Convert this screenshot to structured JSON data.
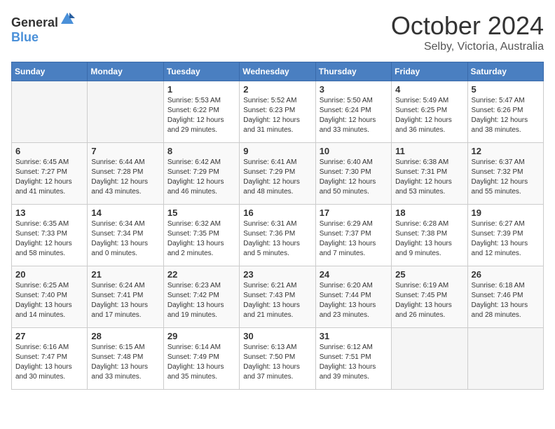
{
  "header": {
    "logo_general": "General",
    "logo_blue": "Blue",
    "month": "October 2024",
    "location": "Selby, Victoria, Australia"
  },
  "days_of_week": [
    "Sunday",
    "Monday",
    "Tuesday",
    "Wednesday",
    "Thursday",
    "Friday",
    "Saturday"
  ],
  "weeks": [
    [
      {
        "day": "",
        "sunrise": "",
        "sunset": "",
        "daylight": ""
      },
      {
        "day": "",
        "sunrise": "",
        "sunset": "",
        "daylight": ""
      },
      {
        "day": "1",
        "sunrise": "Sunrise: 5:53 AM",
        "sunset": "Sunset: 6:22 PM",
        "daylight": "Daylight: 12 hours and 29 minutes."
      },
      {
        "day": "2",
        "sunrise": "Sunrise: 5:52 AM",
        "sunset": "Sunset: 6:23 PM",
        "daylight": "Daylight: 12 hours and 31 minutes."
      },
      {
        "day": "3",
        "sunrise": "Sunrise: 5:50 AM",
        "sunset": "Sunset: 6:24 PM",
        "daylight": "Daylight: 12 hours and 33 minutes."
      },
      {
        "day": "4",
        "sunrise": "Sunrise: 5:49 AM",
        "sunset": "Sunset: 6:25 PM",
        "daylight": "Daylight: 12 hours and 36 minutes."
      },
      {
        "day": "5",
        "sunrise": "Sunrise: 5:47 AM",
        "sunset": "Sunset: 6:26 PM",
        "daylight": "Daylight: 12 hours and 38 minutes."
      }
    ],
    [
      {
        "day": "6",
        "sunrise": "Sunrise: 6:45 AM",
        "sunset": "Sunset: 7:27 PM",
        "daylight": "Daylight: 12 hours and 41 minutes."
      },
      {
        "day": "7",
        "sunrise": "Sunrise: 6:44 AM",
        "sunset": "Sunset: 7:28 PM",
        "daylight": "Daylight: 12 hours and 43 minutes."
      },
      {
        "day": "8",
        "sunrise": "Sunrise: 6:42 AM",
        "sunset": "Sunset: 7:29 PM",
        "daylight": "Daylight: 12 hours and 46 minutes."
      },
      {
        "day": "9",
        "sunrise": "Sunrise: 6:41 AM",
        "sunset": "Sunset: 7:29 PM",
        "daylight": "Daylight: 12 hours and 48 minutes."
      },
      {
        "day": "10",
        "sunrise": "Sunrise: 6:40 AM",
        "sunset": "Sunset: 7:30 PM",
        "daylight": "Daylight: 12 hours and 50 minutes."
      },
      {
        "day": "11",
        "sunrise": "Sunrise: 6:38 AM",
        "sunset": "Sunset: 7:31 PM",
        "daylight": "Daylight: 12 hours and 53 minutes."
      },
      {
        "day": "12",
        "sunrise": "Sunrise: 6:37 AM",
        "sunset": "Sunset: 7:32 PM",
        "daylight": "Daylight: 12 hours and 55 minutes."
      }
    ],
    [
      {
        "day": "13",
        "sunrise": "Sunrise: 6:35 AM",
        "sunset": "Sunset: 7:33 PM",
        "daylight": "Daylight: 12 hours and 58 minutes."
      },
      {
        "day": "14",
        "sunrise": "Sunrise: 6:34 AM",
        "sunset": "Sunset: 7:34 PM",
        "daylight": "Daylight: 13 hours and 0 minutes."
      },
      {
        "day": "15",
        "sunrise": "Sunrise: 6:32 AM",
        "sunset": "Sunset: 7:35 PM",
        "daylight": "Daylight: 13 hours and 2 minutes."
      },
      {
        "day": "16",
        "sunrise": "Sunrise: 6:31 AM",
        "sunset": "Sunset: 7:36 PM",
        "daylight": "Daylight: 13 hours and 5 minutes."
      },
      {
        "day": "17",
        "sunrise": "Sunrise: 6:29 AM",
        "sunset": "Sunset: 7:37 PM",
        "daylight": "Daylight: 13 hours and 7 minutes."
      },
      {
        "day": "18",
        "sunrise": "Sunrise: 6:28 AM",
        "sunset": "Sunset: 7:38 PM",
        "daylight": "Daylight: 13 hours and 9 minutes."
      },
      {
        "day": "19",
        "sunrise": "Sunrise: 6:27 AM",
        "sunset": "Sunset: 7:39 PM",
        "daylight": "Daylight: 13 hours and 12 minutes."
      }
    ],
    [
      {
        "day": "20",
        "sunrise": "Sunrise: 6:25 AM",
        "sunset": "Sunset: 7:40 PM",
        "daylight": "Daylight: 13 hours and 14 minutes."
      },
      {
        "day": "21",
        "sunrise": "Sunrise: 6:24 AM",
        "sunset": "Sunset: 7:41 PM",
        "daylight": "Daylight: 13 hours and 17 minutes."
      },
      {
        "day": "22",
        "sunrise": "Sunrise: 6:23 AM",
        "sunset": "Sunset: 7:42 PM",
        "daylight": "Daylight: 13 hours and 19 minutes."
      },
      {
        "day": "23",
        "sunrise": "Sunrise: 6:21 AM",
        "sunset": "Sunset: 7:43 PM",
        "daylight": "Daylight: 13 hours and 21 minutes."
      },
      {
        "day": "24",
        "sunrise": "Sunrise: 6:20 AM",
        "sunset": "Sunset: 7:44 PM",
        "daylight": "Daylight: 13 hours and 23 minutes."
      },
      {
        "day": "25",
        "sunrise": "Sunrise: 6:19 AM",
        "sunset": "Sunset: 7:45 PM",
        "daylight": "Daylight: 13 hours and 26 minutes."
      },
      {
        "day": "26",
        "sunrise": "Sunrise: 6:18 AM",
        "sunset": "Sunset: 7:46 PM",
        "daylight": "Daylight: 13 hours and 28 minutes."
      }
    ],
    [
      {
        "day": "27",
        "sunrise": "Sunrise: 6:16 AM",
        "sunset": "Sunset: 7:47 PM",
        "daylight": "Daylight: 13 hours and 30 minutes."
      },
      {
        "day": "28",
        "sunrise": "Sunrise: 6:15 AM",
        "sunset": "Sunset: 7:48 PM",
        "daylight": "Daylight: 13 hours and 33 minutes."
      },
      {
        "day": "29",
        "sunrise": "Sunrise: 6:14 AM",
        "sunset": "Sunset: 7:49 PM",
        "daylight": "Daylight: 13 hours and 35 minutes."
      },
      {
        "day": "30",
        "sunrise": "Sunrise: 6:13 AM",
        "sunset": "Sunset: 7:50 PM",
        "daylight": "Daylight: 13 hours and 37 minutes."
      },
      {
        "day": "31",
        "sunrise": "Sunrise: 6:12 AM",
        "sunset": "Sunset: 7:51 PM",
        "daylight": "Daylight: 13 hours and 39 minutes."
      },
      {
        "day": "",
        "sunrise": "",
        "sunset": "",
        "daylight": ""
      },
      {
        "day": "",
        "sunrise": "",
        "sunset": "",
        "daylight": ""
      }
    ]
  ]
}
